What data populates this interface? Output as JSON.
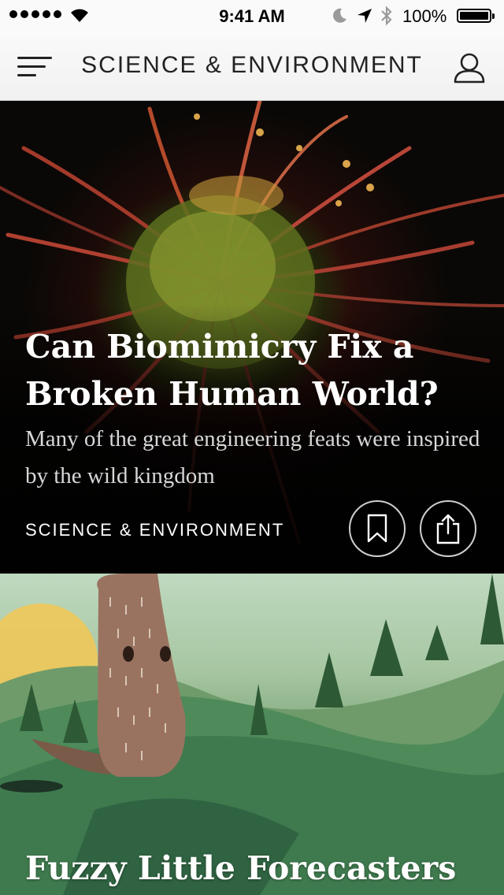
{
  "status_bar": {
    "time": "9:41 AM",
    "battery": "100%",
    "icons": [
      "signal-dots",
      "wifi-icon",
      "moon-icon",
      "location-arrow-icon",
      "bluetooth-icon",
      "battery-icon"
    ]
  },
  "nav": {
    "title": "SCIENCE & ENVIRONMENT",
    "left_icon": "menu-icon",
    "right_icon": "profile-icon"
  },
  "articles": [
    {
      "title": "Can Biomimicry Fix a Broken Human World?",
      "subtitle": "Many of the great engineering feats were inspired by the wild kingdom",
      "category": "SCIENCE & ENVIRONMENT",
      "actions": [
        "bookmark-icon",
        "share-icon"
      ]
    },
    {
      "title": "Fuzzy Little Forecasters"
    }
  ],
  "colors": {
    "status_bg": "#fafafa",
    "nav_bg": "#f1f1f1",
    "text_dark": "#222222",
    "overlay_text": "#ffffff",
    "subtitle_text": "#d7d7d7"
  }
}
